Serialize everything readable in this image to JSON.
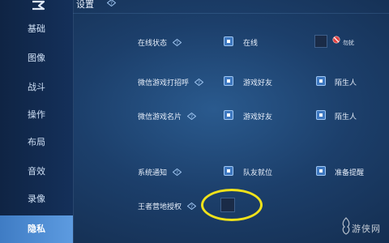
{
  "header": {
    "title": "设置"
  },
  "sidebar": {
    "items": [
      {
        "label": "基础"
      },
      {
        "label": "图像"
      },
      {
        "label": "战斗"
      },
      {
        "label": "操作"
      },
      {
        "label": "布局"
      },
      {
        "label": "音效"
      },
      {
        "label": "录像"
      },
      {
        "label": "隐私"
      }
    ],
    "active_index": 7
  },
  "rows": {
    "online_status": {
      "label": "在线状态",
      "option1": "在线",
      "option1_checked": true,
      "option2": "勿扰",
      "option2_checked": false
    },
    "wechat_greet": {
      "label": "微信游戏打招呼",
      "option1": "游戏好友",
      "option1_checked": true,
      "option2": "陌生人",
      "option2_checked": true
    },
    "wechat_card": {
      "label": "微信游戏名片",
      "option1": "游戏好友",
      "option1_checked": true,
      "option2": "陌生人",
      "option2_checked": true
    },
    "system_notice": {
      "label": "系统通知",
      "option1": "队友就位",
      "option1_checked": true,
      "option2": "准备提醒",
      "option2_checked": true
    },
    "camp_auth": {
      "label": "王者营地授权",
      "checked": false
    }
  },
  "watermark": {
    "text": "游侠网"
  },
  "colors": {
    "accent": "#3e78c0",
    "highlight_ring": "#f0e21a",
    "active_tab": "#4f8dd4"
  }
}
